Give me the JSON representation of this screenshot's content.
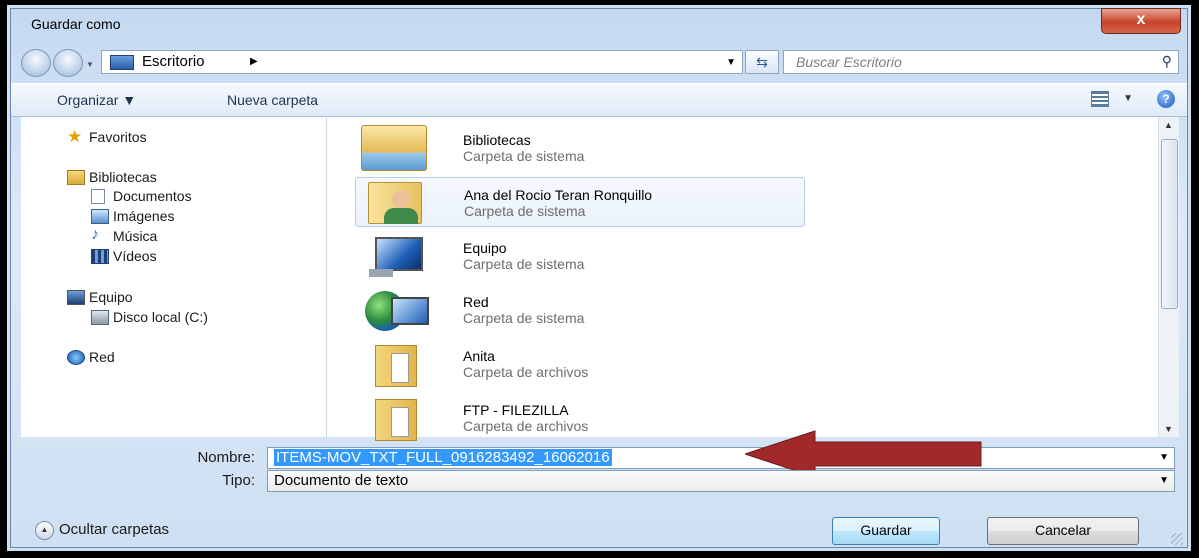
{
  "window": {
    "title": "Guardar como",
    "close_label": "x"
  },
  "navbar": {
    "location": "Escritorio",
    "search_placeholder": "Buscar Escritorio"
  },
  "toolbar": {
    "organize": "Organizar ▼",
    "new_folder": "Nueva carpeta"
  },
  "sidebar": {
    "favorites": "Favoritos",
    "libraries": "Bibliotecas",
    "lib_items": [
      "Documentos",
      "Imágenes",
      "Música",
      "Vídeos"
    ],
    "computer": "Equipo",
    "drive": "Disco local (C:)",
    "network": "Red"
  },
  "files": [
    {
      "name": "Bibliotecas",
      "type": "Carpeta de sistema",
      "icon": "libraries-icon"
    },
    {
      "name": "Ana del Rocio Teran Ronquillo",
      "type": "Carpeta de sistema",
      "icon": "user-folder-icon",
      "selected": true
    },
    {
      "name": "Equipo",
      "type": "Carpeta de sistema",
      "icon": "computer-icon"
    },
    {
      "name": "Red",
      "type": "Carpeta de sistema",
      "icon": "network-icon"
    },
    {
      "name": "Anita",
      "type": "Carpeta de archivos",
      "icon": "folder-icon"
    },
    {
      "name": "FTP - FILEZILLA",
      "type": "Carpeta de archivos",
      "icon": "folder-icon"
    }
  ],
  "form": {
    "name_label": "Nombre:",
    "name_value": "ITEMS-MOV_TXT_FULL_0916283492_16062016",
    "type_label": "Tipo:",
    "type_value": "Documento de texto"
  },
  "footer": {
    "hide_folders": "Ocultar carpetas",
    "save": "Guardar",
    "cancel": "Cancelar"
  },
  "colors": {
    "arrow": "#a3282a",
    "selection": "#3399ff"
  }
}
